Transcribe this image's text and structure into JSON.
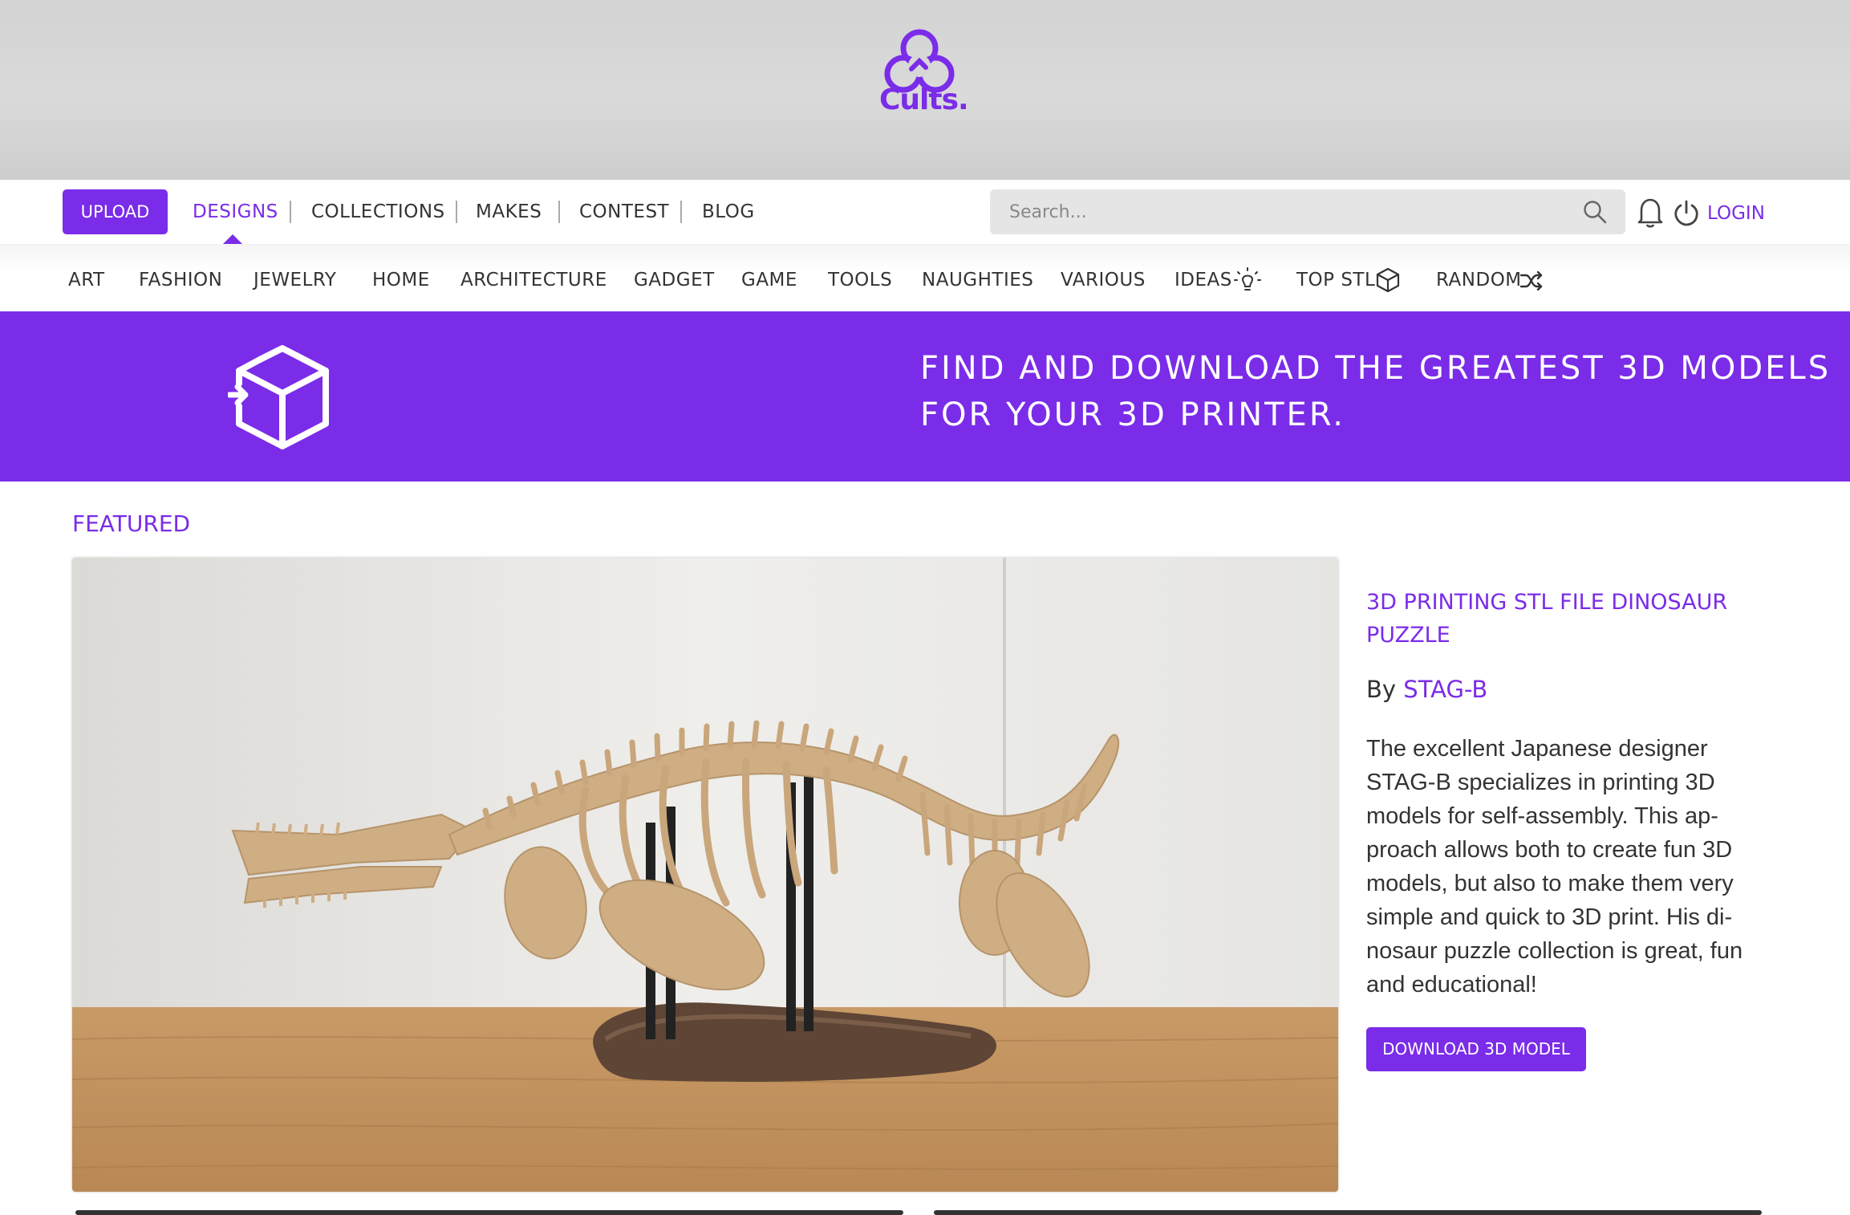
{
  "brand": {
    "name": "Cults.",
    "color": "#7a2ce8"
  },
  "nav": {
    "upload_label": "UPLOAD",
    "items": [
      {
        "label": "DESIGNS",
        "active": true
      },
      {
        "label": "COLLECTIONS",
        "active": false
      },
      {
        "label": "MAKES",
        "active": false
      },
      {
        "label": "CONTEST",
        "active": false
      },
      {
        "label": "BLOG",
        "active": false
      }
    ],
    "search_placeholder": "Search...",
    "login_label": "LOGIN",
    "icons": [
      "search-icon",
      "bell-icon",
      "power-icon"
    ]
  },
  "categories": [
    {
      "label": "ART"
    },
    {
      "label": "FASHION"
    },
    {
      "label": "JEWELRY"
    },
    {
      "label": "HOME"
    },
    {
      "label": "ARCHITECTURE"
    },
    {
      "label": "GADGET"
    },
    {
      "label": "GAME"
    },
    {
      "label": "TOOLS"
    },
    {
      "label": "NAUGHTIES"
    },
    {
      "label": "VARIOUS"
    },
    {
      "label": "IDEAS",
      "icon": "lightbulb-icon"
    },
    {
      "label": "TOP STL",
      "icon": "cube-icon"
    },
    {
      "label": "RANDOM",
      "icon": "shuffle-icon"
    }
  ],
  "banner": {
    "line1": "FIND AND DOWNLOAD THE GREATEST 3D MODELS",
    "line2": "FOR YOUR 3D PRINTER.",
    "icon": "cube-download-icon"
  },
  "featured": {
    "section_title": "FEATURED",
    "image_subject": "dinosaur-skeleton-puzzle-photo",
    "model_title": "3D PRINTING STL FILE DINOSAUR PUZZLE",
    "by_label": "By",
    "author": "STAG-B",
    "description": "The excellent Japanese designer STAG-B specializes in printing 3D models for self-assembly. This ap-proach allows both to create fun 3D models, but also to make them very simple and quick to 3D print. His di-nosaur puzzle collection is great, fun and educational!",
    "download_label": "DOWNLOAD 3D MODEL"
  }
}
